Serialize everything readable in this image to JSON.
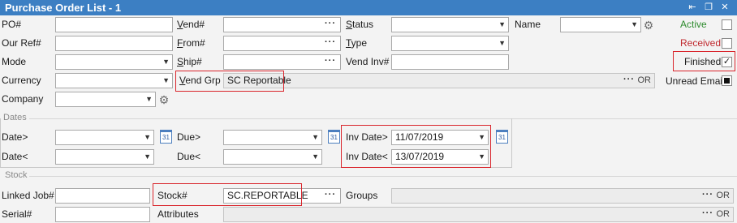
{
  "window": {
    "title": "Purchase Order List - 1",
    "controls": [
      "pin-icon",
      "restore-icon",
      "close-icon"
    ]
  },
  "labels": {
    "po": "PO#",
    "vend": "Vend#",
    "status": "Status",
    "name": "Name",
    "ourref": "Our Ref#",
    "from": "From#",
    "type": "Type",
    "mode": "Mode",
    "ship": "Ship#",
    "vendinv": "Vend Inv#",
    "currency": "Currency",
    "vendgrp": "Vend Grp",
    "company": "Company",
    "date_gt": "Date>",
    "due_gt": "Due>",
    "invdate_gt": "Inv Date>",
    "date_lt": "Date<",
    "due_lt": "Due<",
    "invdate_lt": "Inv Date<",
    "linkedjob": "Linked Job#",
    "stock": "Stock#",
    "groups": "Groups",
    "serial": "Serial#",
    "attributes": "Attributes"
  },
  "sections": {
    "dates": "Dates",
    "stock": "Stock"
  },
  "checkboxes": {
    "active": {
      "label": "Active",
      "checked": false,
      "color": "#2e8b2e"
    },
    "received": {
      "label": "Received",
      "checked": false,
      "color": "#c0282d"
    },
    "finished": {
      "label": "Finished",
      "checked": true,
      "mark": "✓"
    },
    "unread": {
      "label": "Unread Email",
      "checked": true
    }
  },
  "values": {
    "vendgrp": "SC Reportable",
    "invdate_gt": "11/07/2019",
    "invdate_lt": "13/07/2019",
    "stock": "SC.REPORTABLE",
    "or": "OR",
    "dots": "···",
    "cal": "31"
  },
  "colors": {
    "titlebar": "#3c7fc3",
    "highlight": "#d9242b"
  }
}
